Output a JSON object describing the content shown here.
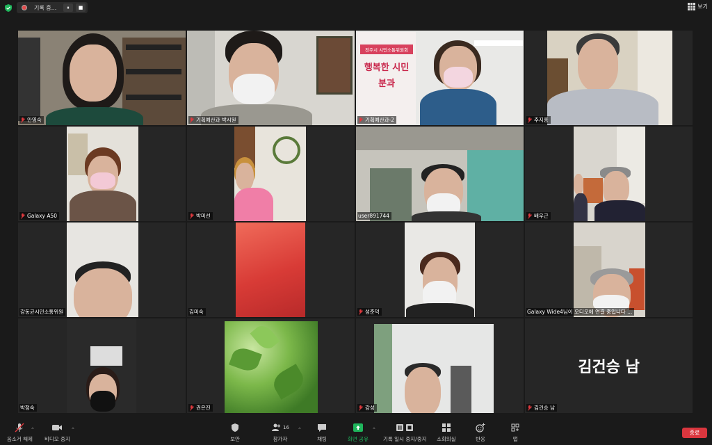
{
  "topbar": {
    "recording_label": "기록 중...",
    "pause_glyph": "⏸",
    "stop_glyph": "■",
    "view_label": "보기"
  },
  "participants": [
    {
      "name": "안영숙",
      "muted": true
    },
    {
      "name": "기획예산과 박시원",
      "muted": true
    },
    {
      "name": "기획예산과-2",
      "muted": true,
      "active_speaker": true,
      "banner_top": "전주시 시민소통위원회",
      "banner_main": "행복한 시민",
      "banner_sub": "분과"
    },
    {
      "name": "주지홍",
      "muted": true
    },
    {
      "name": "Galaxy A50",
      "muted": true
    },
    {
      "name": "박미선",
      "muted": true
    },
    {
      "name": "user891744",
      "muted": false
    },
    {
      "name": "배우근",
      "muted": true
    },
    {
      "name": "강동균시민소통위원",
      "muted": false
    },
    {
      "name": "김미숙",
      "muted": false
    },
    {
      "name": "성준덕",
      "muted": true
    },
    {
      "name": "Galaxy Wide4님이 오디오에 연결 중입니다 ...",
      "muted": false
    },
    {
      "name": "박정숙",
      "muted": false
    },
    {
      "name": "권은진",
      "muted": true
    },
    {
      "name": "강성",
      "muted": true
    },
    {
      "name": "김건승 남",
      "muted": true,
      "video_off_label": "김건승 남"
    }
  ],
  "toolbar": {
    "unmute_label": "음소거 해제",
    "video_label": "비디오 중지",
    "security_label": "보안",
    "participants_label": "참가자",
    "participants_count": "16",
    "chat_label": "채팅",
    "share_label": "화면 공유",
    "record_label": "기록 일시 중지/중지",
    "breakout_label": "소회의실",
    "reactions_label": "반응",
    "apps_label": "앱",
    "end_label": "종료"
  },
  "colors": {
    "background": "#1a1a1a",
    "tile": "#262626",
    "active_border": "#9ad32a",
    "muted_icon": "#e0393e",
    "share_green": "#1fb65c",
    "end_red": "#d9363e"
  }
}
